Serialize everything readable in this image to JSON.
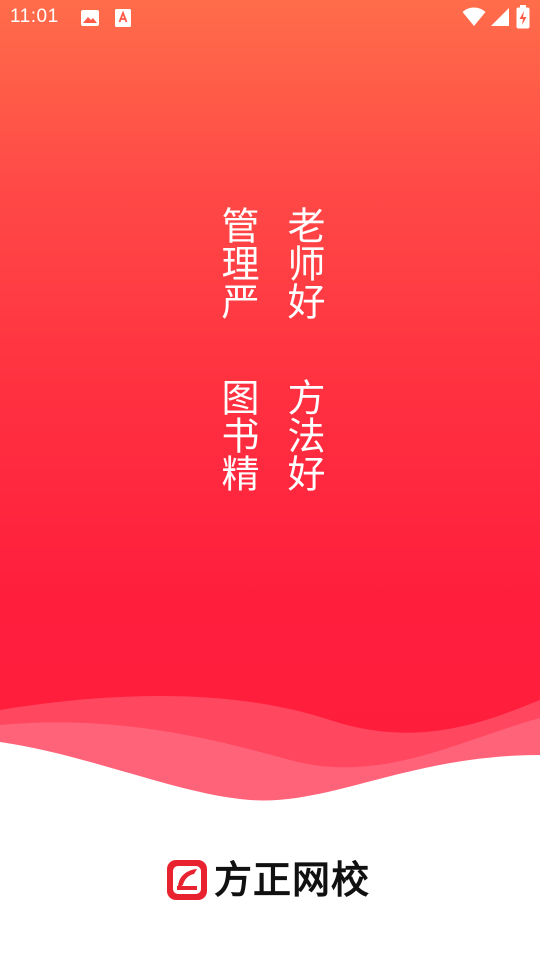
{
  "status_bar": {
    "time": "11:01",
    "icons": [
      "image-icon",
      "text-notification-icon",
      "wifi-icon",
      "cellular-signal-icon",
      "battery-charging-icon"
    ]
  },
  "slogans": {
    "right_column_1": "老师好",
    "left_column_1": "管理严",
    "right_column_2": "方法好",
    "left_column_2": "图书精"
  },
  "brand": {
    "name": "方正网校",
    "logo_icon": "brand-logo-icon"
  },
  "colors": {
    "gradient_top": "#ff6d4a",
    "gradient_bottom": "#ff1c3c",
    "wave_light": "#ff5a70",
    "logo_red": "#e8232f",
    "background": "#ffffff"
  }
}
